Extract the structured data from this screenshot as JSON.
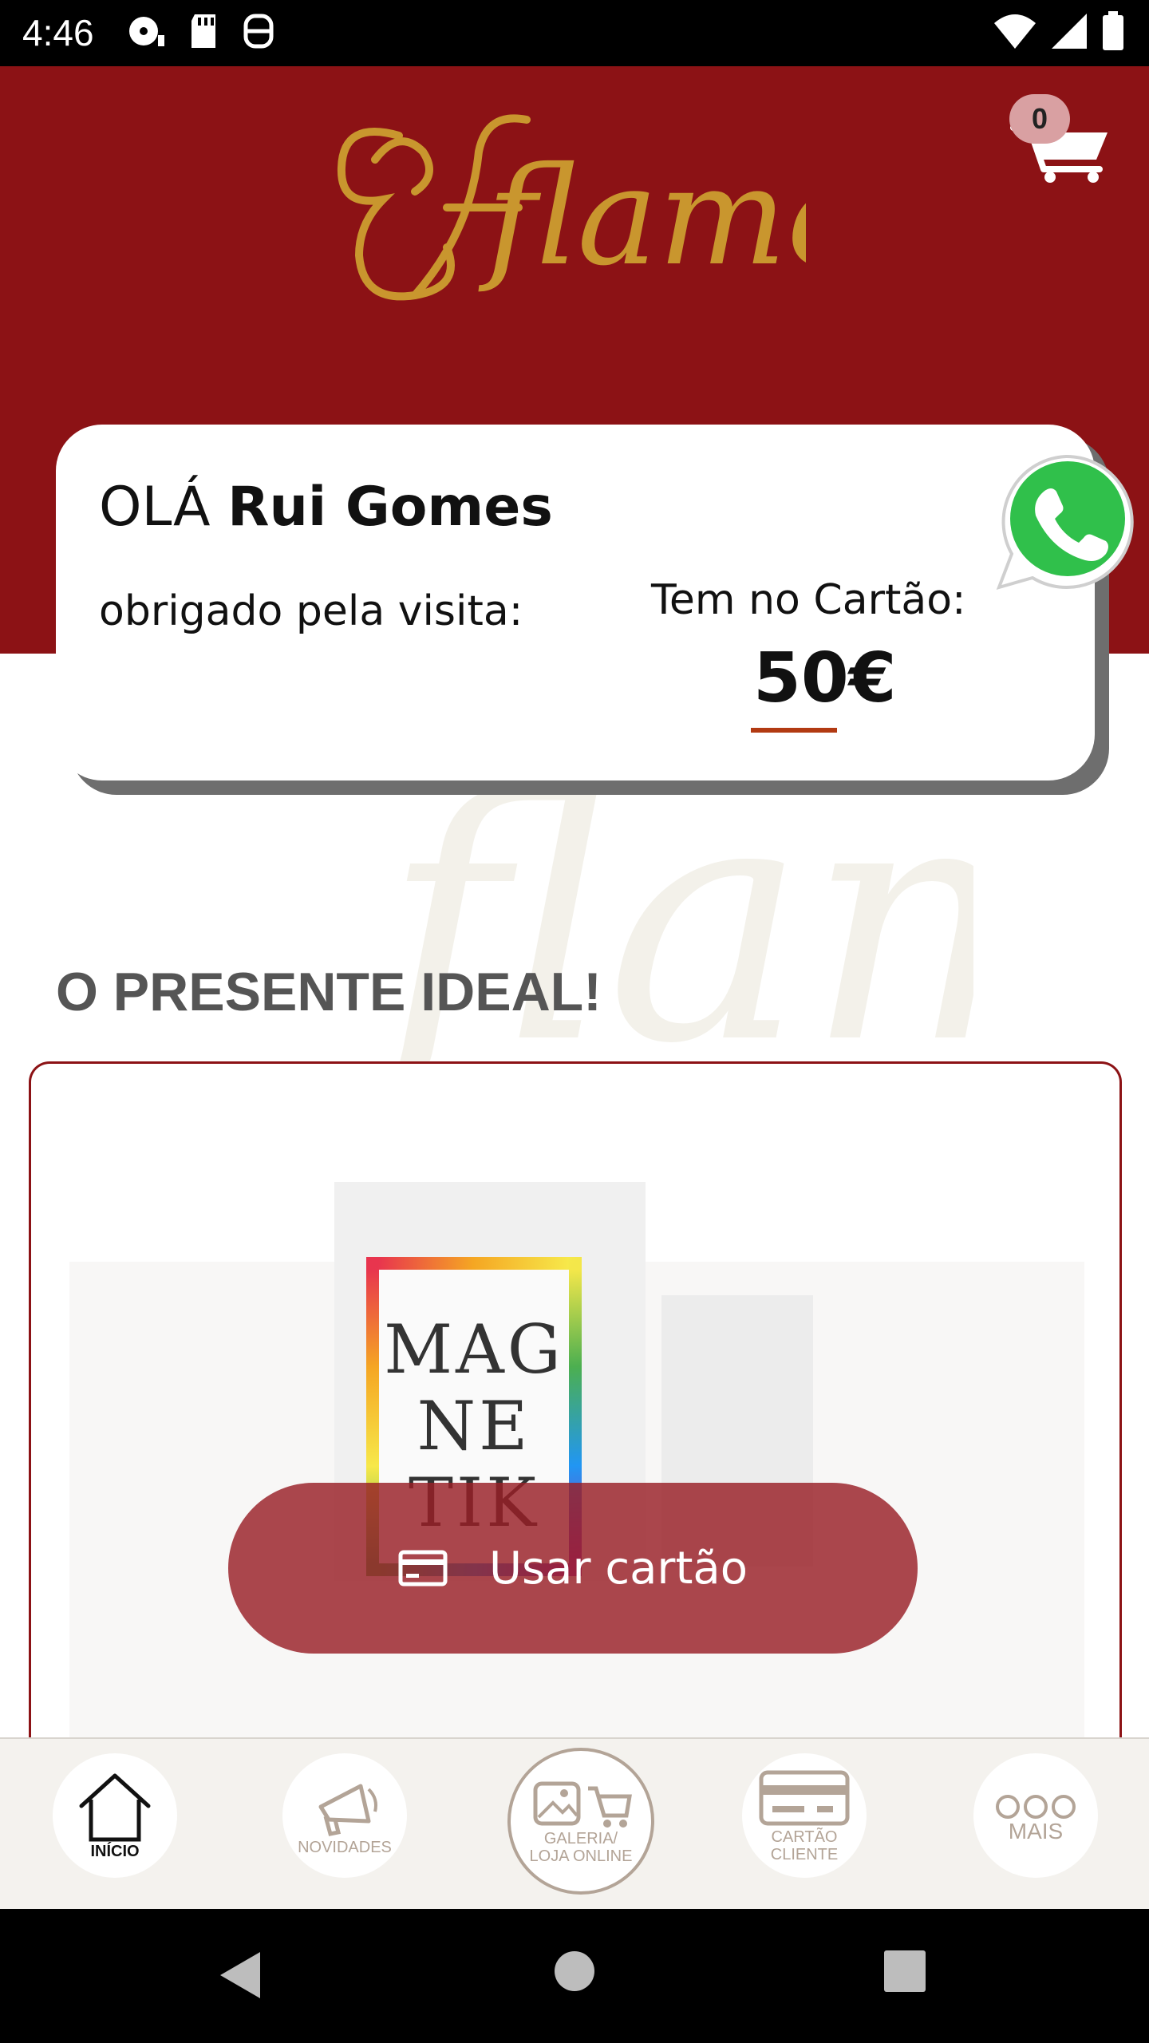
{
  "status_bar": {
    "time": "4:46"
  },
  "header": {
    "logo_text": "flame",
    "cart_count": "0"
  },
  "greeting": {
    "hello": "OLÁ",
    "name": "Rui Gomes",
    "visit_text": "obrigado pela visita:",
    "card_label": "Tem no Cartão:",
    "card_amount": "50€"
  },
  "section": {
    "title": "O PRESENTE IDEAL!"
  },
  "product": {
    "box_text": "MAG NE TIK"
  },
  "use_card": {
    "label": "Usar cartão"
  },
  "bottom_nav": {
    "items": [
      {
        "label": "INÍCIO"
      },
      {
        "label": "NOVIDADES"
      },
      {
        "label": "GALERIA/ LOJA ONLINE"
      },
      {
        "label": "CARTÃO CLIENTE"
      },
      {
        "label": "MAIS"
      }
    ]
  },
  "colors": {
    "brand_red": "#8c1215",
    "gold": "#c9962e",
    "nav_muted": "#b3a497"
  }
}
